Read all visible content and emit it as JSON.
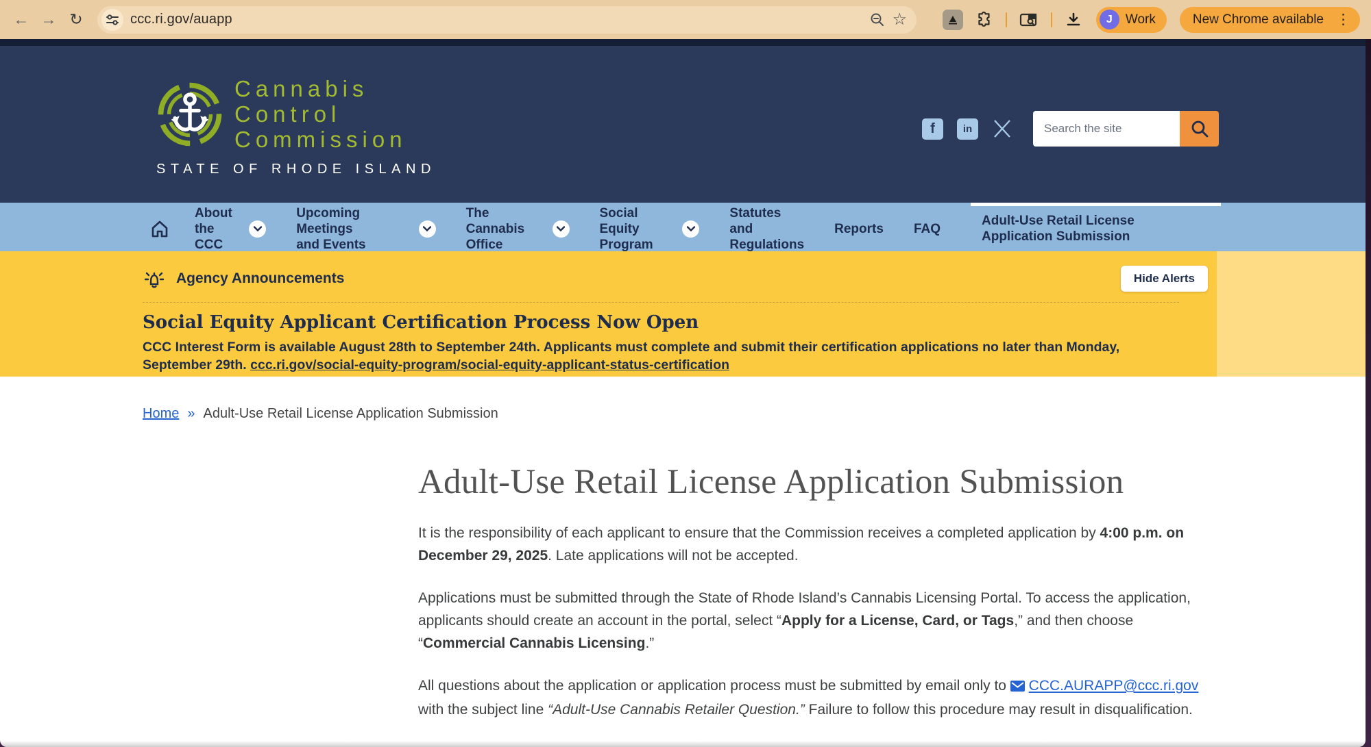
{
  "browser": {
    "url": "ccc.ri.gov/auapp",
    "profile": {
      "initial": "J",
      "label": "Work"
    },
    "update_label": "New Chrome available"
  },
  "header": {
    "wordmark": {
      "line1": "Cannabis",
      "line2": "Control",
      "line3": "Commission"
    },
    "tagline": "STATE OF RHODE ISLAND",
    "search_placeholder": "Search the site",
    "social": {
      "facebook": "f",
      "linkedin": "in"
    }
  },
  "nav": {
    "items": [
      {
        "label": "About\nthe CCC"
      },
      {
        "label": "Upcoming Meetings\nand Events"
      },
      {
        "label": "The Cannabis\nOffice"
      },
      {
        "label": "Social Equity\nProgram"
      },
      {
        "label": "Statutes and\nRegulations"
      },
      {
        "label": "Reports"
      },
      {
        "label": "FAQ"
      },
      {
        "label": "Adult-Use Retail License\nApplication Submission"
      }
    ]
  },
  "alert": {
    "title": "Agency Announcements",
    "hide_button": "Hide Alerts",
    "heading": "Social Equity Applicant Certification Process Now Open",
    "body": "CCC Interest Form is available August 28th to September 24th.  Applicants must complete and submit their certification applications no later than Monday, September 29th. ",
    "link": "ccc.ri.gov/social-equity-program/social-equity-applicant-status-certification"
  },
  "breadcrumb": {
    "home": "Home",
    "separator": "»",
    "current": "Adult-Use Retail License Application Submission"
  },
  "article": {
    "title": "Adult-Use Retail License Application Submission",
    "p1_a": "It is the responsibility of each applicant to ensure that the Commission receives a completed application by ",
    "p1_b": "4:00 p.m. on December 29, 2025",
    "p1_c": ". Late applications will not be accepted.",
    "p2_a": "Applications must be submitted through the State of Rhode Island’s Cannabis Licensing Portal. To access the application, applicants should create an account in the portal, select “",
    "p2_b": "Apply for a License, Card, or Tags",
    "p2_c": ",” and then choose “",
    "p2_d": "Commercial Cannabis Licensing",
    "p2_e": ".”",
    "p3_a": "All questions about the application or application process must be submitted by email only to ",
    "p3_link": "CCC.AURAPP@ccc.ri.gov",
    "p3_b": " with the subject line ",
    "p3_c": "“Adult-Use Cannabis Retailer Question.”",
    "p3_d": " Failure to follow this procedure may result in disqualification."
  },
  "colors": {
    "toolbar_tan": "#ebcda4",
    "pill_orange": "#f4a83e",
    "header_navy": "#2b3a5a",
    "logo_green": "#8fae25",
    "nav_blue": "#8fb7dc",
    "alert_yellow": "#fcca3e",
    "alert_yellow_light": "#fddc85",
    "search_button_orange": "#ef913d",
    "link_blue": "#2463d1"
  }
}
